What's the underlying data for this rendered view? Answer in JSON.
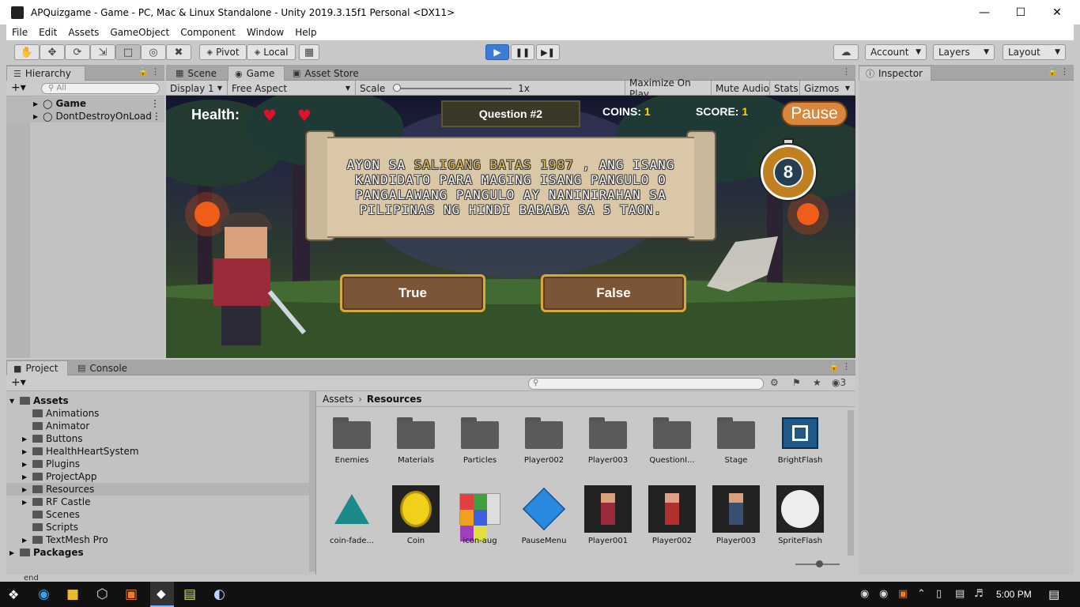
{
  "window": {
    "title": "APQuizgame - Game - PC, Mac & Linux Standalone - Unity 2019.3.15f1 Personal <DX11>"
  },
  "menu": [
    "File",
    "Edit",
    "Assets",
    "GameObject",
    "Component",
    "Window",
    "Help"
  ],
  "toolbar": {
    "pivot_label": "Pivot",
    "local_label": "Local",
    "account_label": "Account",
    "layers_label": "Layers",
    "layout_label": "Layout"
  },
  "hierarchy": {
    "tab_label": "Hierarchy",
    "search_placeholder": "All",
    "items": [
      {
        "label": "Game"
      },
      {
        "label": "DontDestroyOnLoad"
      }
    ]
  },
  "scene_tabs": {
    "scene": "Scene",
    "game": "Game",
    "asset_store": "Asset Store"
  },
  "game_bar": {
    "display": "Display 1",
    "aspect": "Free Aspect",
    "scale_label": "Scale",
    "scale_value": "1x",
    "scale_fraction": 0.0,
    "maximize": "Maximize On Play",
    "mute": "Mute Audio",
    "stats": "Stats",
    "gizmos": "Gizmos"
  },
  "game": {
    "health_label": "Health:",
    "hearts": 2,
    "question_title": "Question #2",
    "coins_label": "COINS:",
    "coins_value": "1",
    "score_label": "SCORE:",
    "score_value": "1",
    "pause_label": "Pause",
    "timer_value": "8",
    "question_text_before": "AYON SA ",
    "question_highlight": "SALIGANG BATAS 1987",
    "question_text_after": " , ANG ISANG KANDIDATO PARA MAGING ISANG PANGULO O PANGALAWANG PANGULO AY NANINIRAHAN SA PILIPINAS NG HINDI BABABA SA 5 TAON.",
    "true_label": "True",
    "false_label": "False"
  },
  "inspector": {
    "tab_label": "Inspector"
  },
  "project": {
    "tab_project": "Project",
    "tab_console": "Console",
    "hidden_count": "3",
    "breadcrumb_root": "Assets",
    "breadcrumb_current": "Resources",
    "tree": [
      {
        "label": "Assets",
        "bold": true
      },
      {
        "label": "Animations"
      },
      {
        "label": "Animator"
      },
      {
        "label": "Buttons"
      },
      {
        "label": "HealthHeartSystem"
      },
      {
        "label": "Plugins"
      },
      {
        "label": "ProjectApp"
      },
      {
        "label": "Resources"
      },
      {
        "label": "RF Castle"
      },
      {
        "label": "Scenes"
      },
      {
        "label": "Scripts"
      },
      {
        "label": "TextMesh Pro"
      },
      {
        "label": "Packages",
        "bold": true
      }
    ],
    "assets_row1": [
      "Enemies",
      "Materials",
      "Particles",
      "Player002",
      "Player003",
      "QuestionI...",
      "Stage",
      "BrightFlash"
    ],
    "assets_row2": [
      "coin-fade...",
      "Coin",
      "icon-aug",
      "PauseMenu",
      "Player001",
      "Player002",
      "Player003",
      "SpriteFlash"
    ]
  },
  "status": {
    "text": "end"
  },
  "taskbar": {
    "time": "5:00 PM"
  }
}
